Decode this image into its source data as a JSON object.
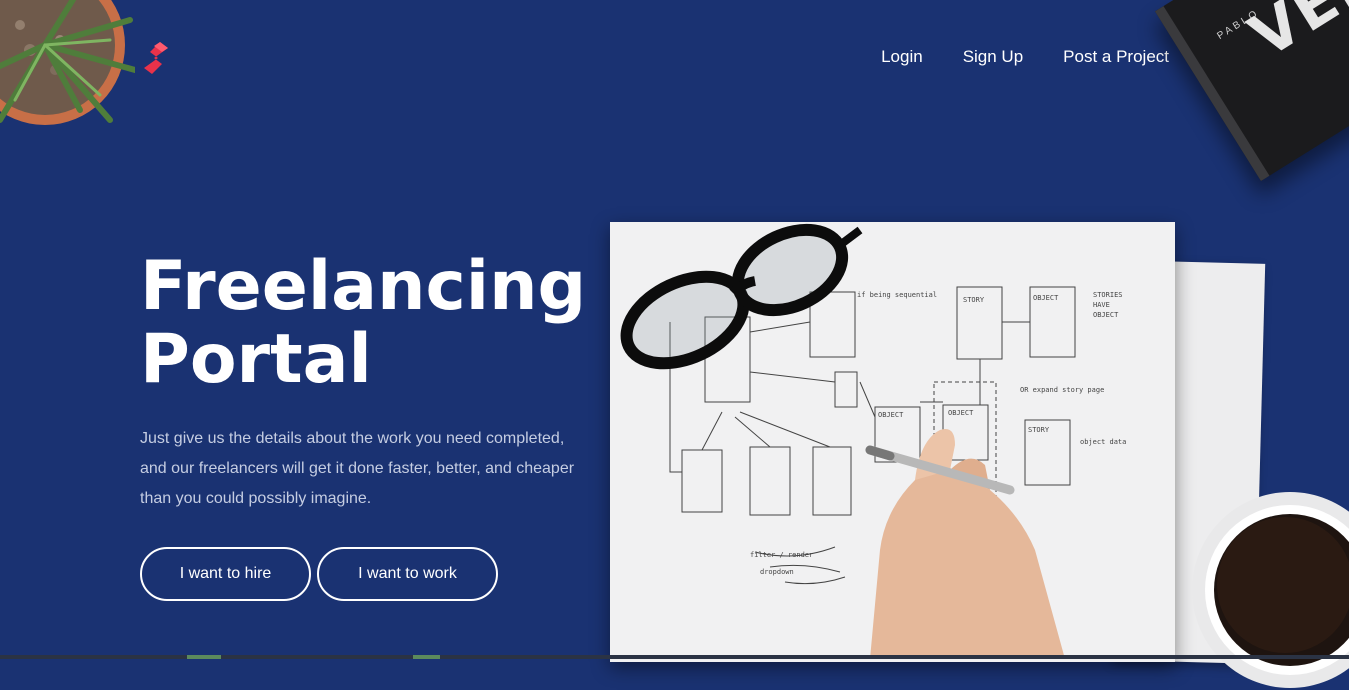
{
  "nav": {
    "login": "Login",
    "signup": "Sign Up",
    "post_project": "Post a Project"
  },
  "hero": {
    "title_line1": "Freelancing",
    "title_line2": "Portal",
    "description": "Just give us the details about the work you need completed, and our freelancers will get it done faster, better, and cheaper than you could possibly imagine.",
    "hire_button": "I want to hire",
    "work_button": "I want to work"
  },
  "decor": {
    "book_title": "VERB",
    "book_brand": "PABLO"
  },
  "colors": {
    "background": "#1a3272",
    "logo_accent": "#e8324a",
    "text_primary": "#ffffff",
    "text_muted": "#c5cde2"
  },
  "icons": {
    "logo": "brand-s-logo-icon",
    "plant": "potted-plant-image",
    "glasses": "eyeglasses-image",
    "hand": "hand-with-pen-image",
    "coffee": "coffee-cup-image"
  }
}
